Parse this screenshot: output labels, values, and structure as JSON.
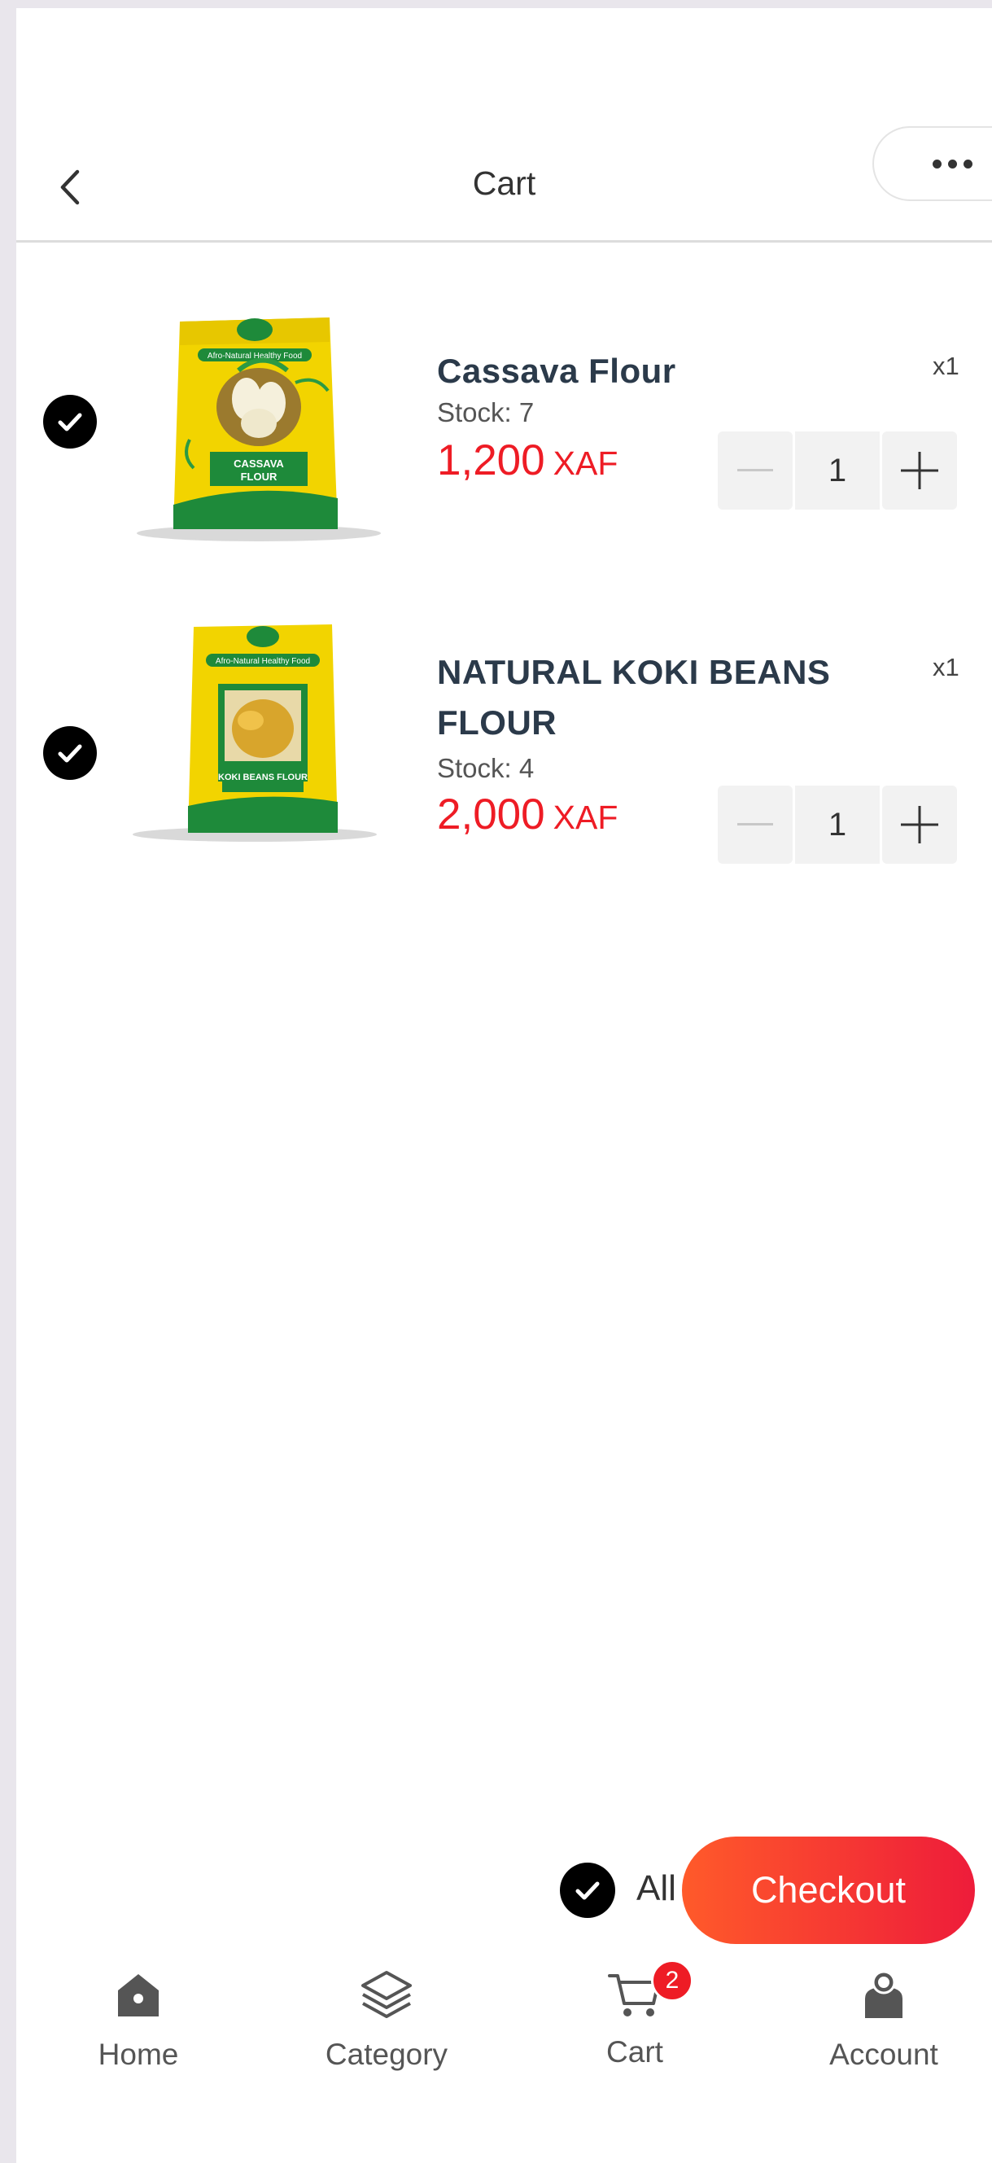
{
  "header": {
    "title": "Cart"
  },
  "items": [
    {
      "name": "Cassava Flour",
      "stock": "Stock: 7",
      "price": "1,200",
      "currency": "XAF",
      "count": "x1",
      "qty": "1",
      "pack_label": "CASSAVA FLOUR",
      "pack_banner": "Afro-Natural Healthy Food"
    },
    {
      "name": "NATURAL KOKI BEANS FLOUR",
      "stock": "Stock: 4",
      "price": "2,000",
      "currency": "XAF",
      "count": "x1",
      "qty": "1",
      "pack_label": "KOKI BEANS FLOUR",
      "pack_banner": "Afro-Natural Healthy Food"
    }
  ],
  "footer": {
    "all_label": "All",
    "checkout_label": "Checkout"
  },
  "nav": {
    "home": "Home",
    "category": "Category",
    "cart": "Cart",
    "cart_badge": "2",
    "account": "Account"
  },
  "colors": {
    "price": "#ee1c25",
    "checkout_start": "#ff5a2a",
    "checkout_end": "#ee1c3a",
    "package_yellow": "#f2d400",
    "package_green": "#1e8a3a"
  },
  "icons": [
    "chevron-left-icon",
    "more-horizontal-icon",
    "check-circle-icon",
    "minus-icon",
    "plus-icon",
    "home-icon",
    "layers-icon",
    "cart-icon",
    "account-icon"
  ]
}
